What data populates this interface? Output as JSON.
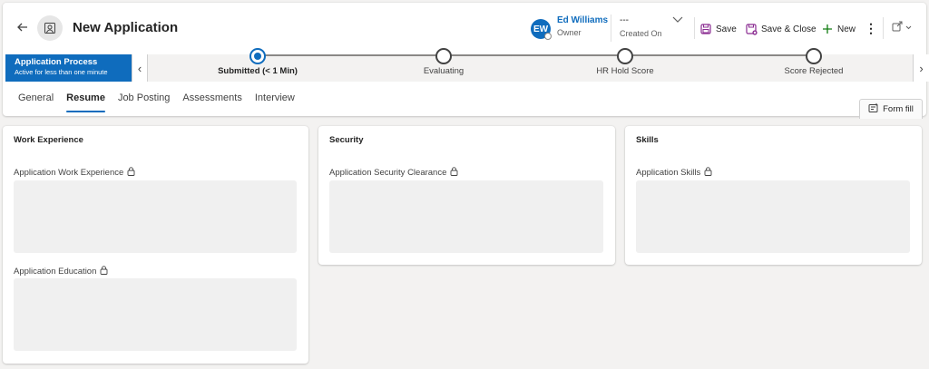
{
  "header": {
    "title": "New Application",
    "owner": {
      "initials": "EW",
      "name": "Ed Williams",
      "label": "Owner"
    },
    "created": {
      "value": "---",
      "label": "Created On"
    }
  },
  "commands": {
    "save": "Save",
    "save_close": "Save & Close",
    "new": "New"
  },
  "process": {
    "name": "Application Process",
    "duration": "Active for less than one minute",
    "stages": [
      {
        "label": "Submitted  (< 1 Min)",
        "active": true
      },
      {
        "label": "Evaluating",
        "active": false
      },
      {
        "label": "HR Hold Score",
        "active": false
      },
      {
        "label": "Score Rejected",
        "active": false
      }
    ]
  },
  "tabs": [
    "General",
    "Resume",
    "Job Posting",
    "Assessments",
    "Interview"
  ],
  "active_tab": "Resume",
  "form_fill": "Form fill",
  "sections": {
    "work": {
      "title": "Work Experience",
      "fields": [
        "Application Work Experience",
        "Application Education"
      ]
    },
    "security": {
      "title": "Security",
      "fields": [
        "Application Security Clearance"
      ]
    },
    "skills": {
      "title": "Skills",
      "fields": [
        "Application Skills"
      ]
    }
  },
  "colors": {
    "accent": "#0f6cbd",
    "save_icon": "#8a2b91",
    "new_icon": "#107c10"
  }
}
